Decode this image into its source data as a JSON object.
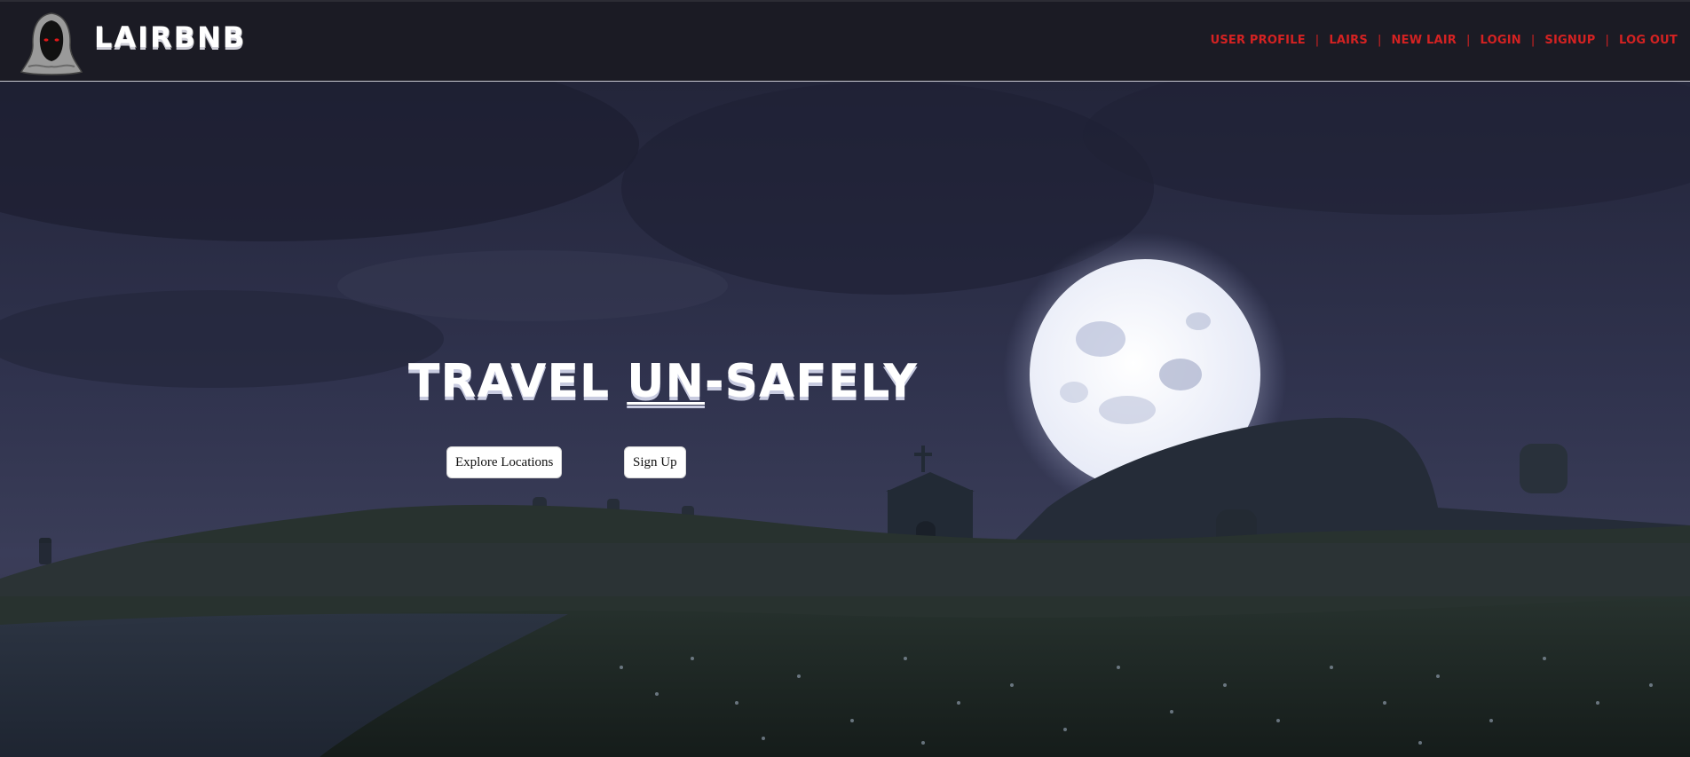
{
  "brand": {
    "name": "LAIRBNB"
  },
  "nav": {
    "items": [
      {
        "label": "USER PROFILE"
      },
      {
        "label": "LAIRS"
      },
      {
        "label": "NEW LAIR"
      },
      {
        "label": "LOGIN"
      },
      {
        "label": "SIGNUP"
      },
      {
        "label": "LOG OUT"
      }
    ],
    "separator": "|"
  },
  "hero": {
    "tagline_before": "TRAVEL ",
    "tagline_emphasis": "UN",
    "tagline_after": "-SAFELY",
    "explore_button": "Explore Locations",
    "signup_button": "Sign Up"
  },
  "colors": {
    "nav_background": "#1b1b24",
    "nav_link": "#d42222",
    "sky": "#2a2c44",
    "moon": "#f4f6ff"
  },
  "icons": {
    "logo": "hooded-reaper-icon"
  }
}
